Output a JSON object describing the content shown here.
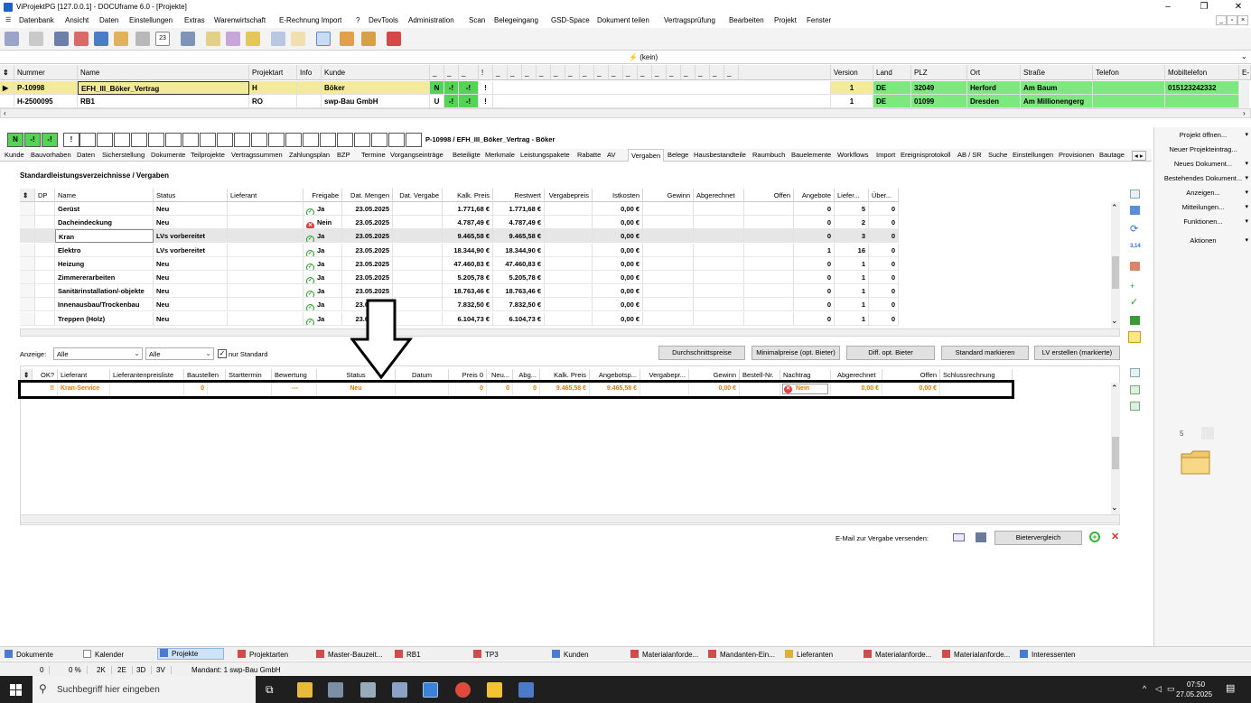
{
  "window": {
    "title": "ViProjektPG [127.0.0.1] - DOCUframe 6.0 - [Projekte]"
  },
  "menu": [
    "Datenbank",
    "Ansicht",
    "Daten",
    "Einstellungen",
    "Extras",
    "Warenwirtschaft",
    "E-Rechnung Import",
    "?",
    "DevTools",
    "Administration",
    "Scan",
    "Belegeingang",
    "GSD-Space",
    "Dokument teilen",
    "Vertragsprüfung",
    "Bearbeiten",
    "Projekt",
    "Fenster"
  ],
  "filter": {
    "label": "(kein)"
  },
  "projects": {
    "columns": [
      "Nummer",
      "Name",
      "Projektart",
      "Info",
      "Kunde",
      "_",
      "_",
      "_",
      "!",
      "_",
      "_",
      "_",
      "_",
      "_",
      "_",
      "_",
      "_",
      "_",
      "_",
      "_",
      "_",
      "_",
      "_",
      "_",
      "_",
      "_",
      "Version",
      "Land",
      "PLZ",
      "Ort",
      "Straße",
      "Telefon",
      "Mobiltelefon",
      "E-"
    ],
    "rows": [
      {
        "nummer": "P-10998",
        "name": "EFH_III_Böker_Vertrag",
        "art": "H",
        "kunde": "Böker",
        "f1": "N",
        "f2": "-!",
        "f3": "-!",
        "f4": "!",
        "version": "1",
        "land": "DE",
        "plz": "32049",
        "ort": "Herford",
        "strasse": "Am Baum",
        "mobil": "015123242332"
      },
      {
        "nummer": "H-2500095",
        "name": "RB1",
        "art": "RO",
        "kunde": "swp-Bau GmbH",
        "f1": "U",
        "f2": "-!",
        "f3": "-!",
        "f4": "!",
        "version": "1",
        "land": "DE",
        "plz": "01099",
        "ort": "Dresden",
        "strasse": "Am Millionengerg",
        "mobil": ""
      }
    ]
  },
  "statusboxes": [
    "N",
    "-!",
    "-!",
    "!"
  ],
  "current_project": "P-10998 / EFH_III_Böker_Vertrag - Böker",
  "tabs": [
    "Kunde",
    "Bauvorhaben",
    "Daten",
    "Sicherstellung",
    "Dokumente",
    "Teilprojekte",
    "Vertragssummen",
    "Zahlungsplan",
    "BZP",
    "Termine",
    "Vorgangseinträge",
    "Beteiligte",
    "Merkmale",
    "Leistungspakete",
    "Rabatte",
    "AV",
    "Vergaben",
    "Belege",
    "Hausbestandteile",
    "Raumbuch",
    "Bauelemente",
    "Workflows",
    "Import",
    "Ereignisprotokoll",
    "AB / SR",
    "Suche",
    "Einstellungen",
    "Provisionen",
    "Bautage"
  ],
  "section_title": "Standardleistungsverzeichnisse / Vergaben",
  "vergaben": {
    "columns": [
      "DP",
      "Name",
      "Status",
      "Lieferant",
      "Freigabe",
      "Dat. Mengen",
      "Dat. Vergabe",
      "Kalk. Preis",
      "Restwert",
      "Vergabepreis",
      "Istkosten",
      "Gewinn",
      "Abgerechnet",
      "Offen",
      "Angebote",
      "Liefer...",
      "Über..."
    ],
    "rows": [
      {
        "name": "Gerüst",
        "status": "Neu",
        "freigabe": "Ja",
        "ok": true,
        "datm": "23.05.2025",
        "kalk": "1.771,68 €",
        "rest": "1.771,68 €",
        "ist": "0,00 €",
        "ang": "0",
        "lief": "5",
        "ueb": "0"
      },
      {
        "name": "Dacheindeckung",
        "status": "Neu",
        "freigabe": "Nein",
        "ok": false,
        "datm": "23.05.2025",
        "kalk": "4.787,49 €",
        "rest": "4.787,49 €",
        "ist": "0,00 €",
        "ang": "0",
        "lief": "2",
        "ueb": "0"
      },
      {
        "name": "Kran",
        "status": "LVs vorbereitet",
        "freigabe": "Ja",
        "ok": true,
        "datm": "23.05.2025",
        "kalk": "9.465,58 €",
        "rest": "9.465,58 €",
        "ist": "0,00 €",
        "ang": "0",
        "lief": "3",
        "ueb": "0"
      },
      {
        "name": "Elektro",
        "status": "LVs vorbereitet",
        "freigabe": "Ja",
        "ok": true,
        "datm": "23.05.2025",
        "kalk": "18.344,90 €",
        "rest": "18.344,90 €",
        "ist": "0,00 €",
        "ang": "1",
        "lief": "16",
        "ueb": "0"
      },
      {
        "name": "Heizung",
        "status": "Neu",
        "freigabe": "Ja",
        "ok": true,
        "datm": "23.05.2025",
        "kalk": "47.460,83 €",
        "rest": "47.460,83 €",
        "ist": "0,00 €",
        "ang": "0",
        "lief": "1",
        "ueb": "0"
      },
      {
        "name": "Zimmererarbeiten",
        "status": "Neu",
        "freigabe": "Ja",
        "ok": true,
        "datm": "23.05.2025",
        "kalk": "5.205,78 €",
        "rest": "5.205,78 €",
        "ist": "0,00 €",
        "ang": "0",
        "lief": "1",
        "ueb": "0"
      },
      {
        "name": "Sanitärinstallation/-objekte",
        "status": "Neu",
        "freigabe": "Ja",
        "ok": true,
        "datm": "23.05.2025",
        "kalk": "18.763,46 €",
        "rest": "18.763,46 €",
        "ist": "0,00 €",
        "ang": "0",
        "lief": "1",
        "ueb": "0"
      },
      {
        "name": "Innenausbau/Trockenbau",
        "status": "Neu",
        "freigabe": "Ja",
        "ok": true,
        "datm": "23.05.2025",
        "kalk": "7.832,50 €",
        "rest": "7.832,50 €",
        "ist": "0,00 €",
        "ang": "0",
        "lief": "1",
        "ueb": "0"
      },
      {
        "name": "Treppen (Holz)",
        "status": "Neu",
        "freigabe": "Ja",
        "ok": true,
        "datm": "23.05.2025",
        "kalk": "6.104,73 €",
        "rest": "6.104,73 €",
        "ist": "0,00 €",
        "ang": "0",
        "lief": "1",
        "ueb": "0"
      }
    ]
  },
  "controls": {
    "anzeige_label": "Anzeige:",
    "combo1": "Alle",
    "combo2": "Alle",
    "nur_standard": "nur Standard",
    "btn_durchschnitt": "Durchschnittspreise",
    "btn_minimal": "Minimalpreise (opt. Bieter)",
    "btn_diff": "Diff. opt. Bieter",
    "btn_standard": "Standard markieren",
    "btn_lv": "LV erstellen (markierte)"
  },
  "bieter": {
    "columns": [
      "OK?",
      "Lieferant",
      "Lieferantenpreisliste",
      "Baustellen",
      "Starttermin",
      "Bewertung",
      "Status",
      "Datum",
      "Preis 0",
      "Neu...",
      "Abg...",
      "Kalk. Preis",
      "Angebotsp...",
      "Vergabepr...",
      "Gewinn",
      "Bestell-Nr.",
      "Nachtrag",
      "Abgerechnet",
      "Offen",
      "Schlussrechnung"
    ],
    "row": {
      "ok": "!!",
      "lieferant": "Kran-Service",
      "baustellen": "0",
      "bewertung": "---",
      "status": "Neu",
      "preis0": "0",
      "neu": "0",
      "abg": "0",
      "kalk": "9.465,58 €",
      "angebot": "9.465,58 €",
      "gewinn": "0,00 €",
      "nachtrag": "Nein",
      "abgerechnet": "0,00 €",
      "offen": "0,00 €"
    }
  },
  "email": {
    "label": "E-Mail zur Vergabe versenden:",
    "btn": "Bietervergleich"
  },
  "sidebar": [
    "Projekt öffnen...",
    "Neuer Projekteintrag...",
    "Neues Dokument...",
    "Bestehendes Dokument...",
    "Anzeigen...",
    "Mitteilungen...",
    "Funktionen...",
    "Aktionen"
  ],
  "sidebar_count": "5",
  "bottomtabs": [
    "Dokumente",
    "Kalender",
    "Projekte",
    "Projektarten",
    "Master-Bauzeit...",
    "RB1",
    "TP3",
    "Kunden",
    "Materialanforde...",
    "Mandanten-Ein...",
    "Lieferanten",
    "Materialanforde...",
    "Materialanforde...",
    "Interessenten"
  ],
  "statusbar": [
    "0",
    "0 %",
    "2K",
    "2E",
    "3D",
    "3V",
    "Mandant: 1 swp-Bau GmbH"
  ],
  "taskbar": {
    "search": "Suchbegriff hier eingeben",
    "time": "07:50",
    "date": "27.05.2025"
  },
  "colors": {
    "highlight_yellow": "#f3eb99",
    "green": "#7de87d",
    "orange": "#e07b00"
  }
}
